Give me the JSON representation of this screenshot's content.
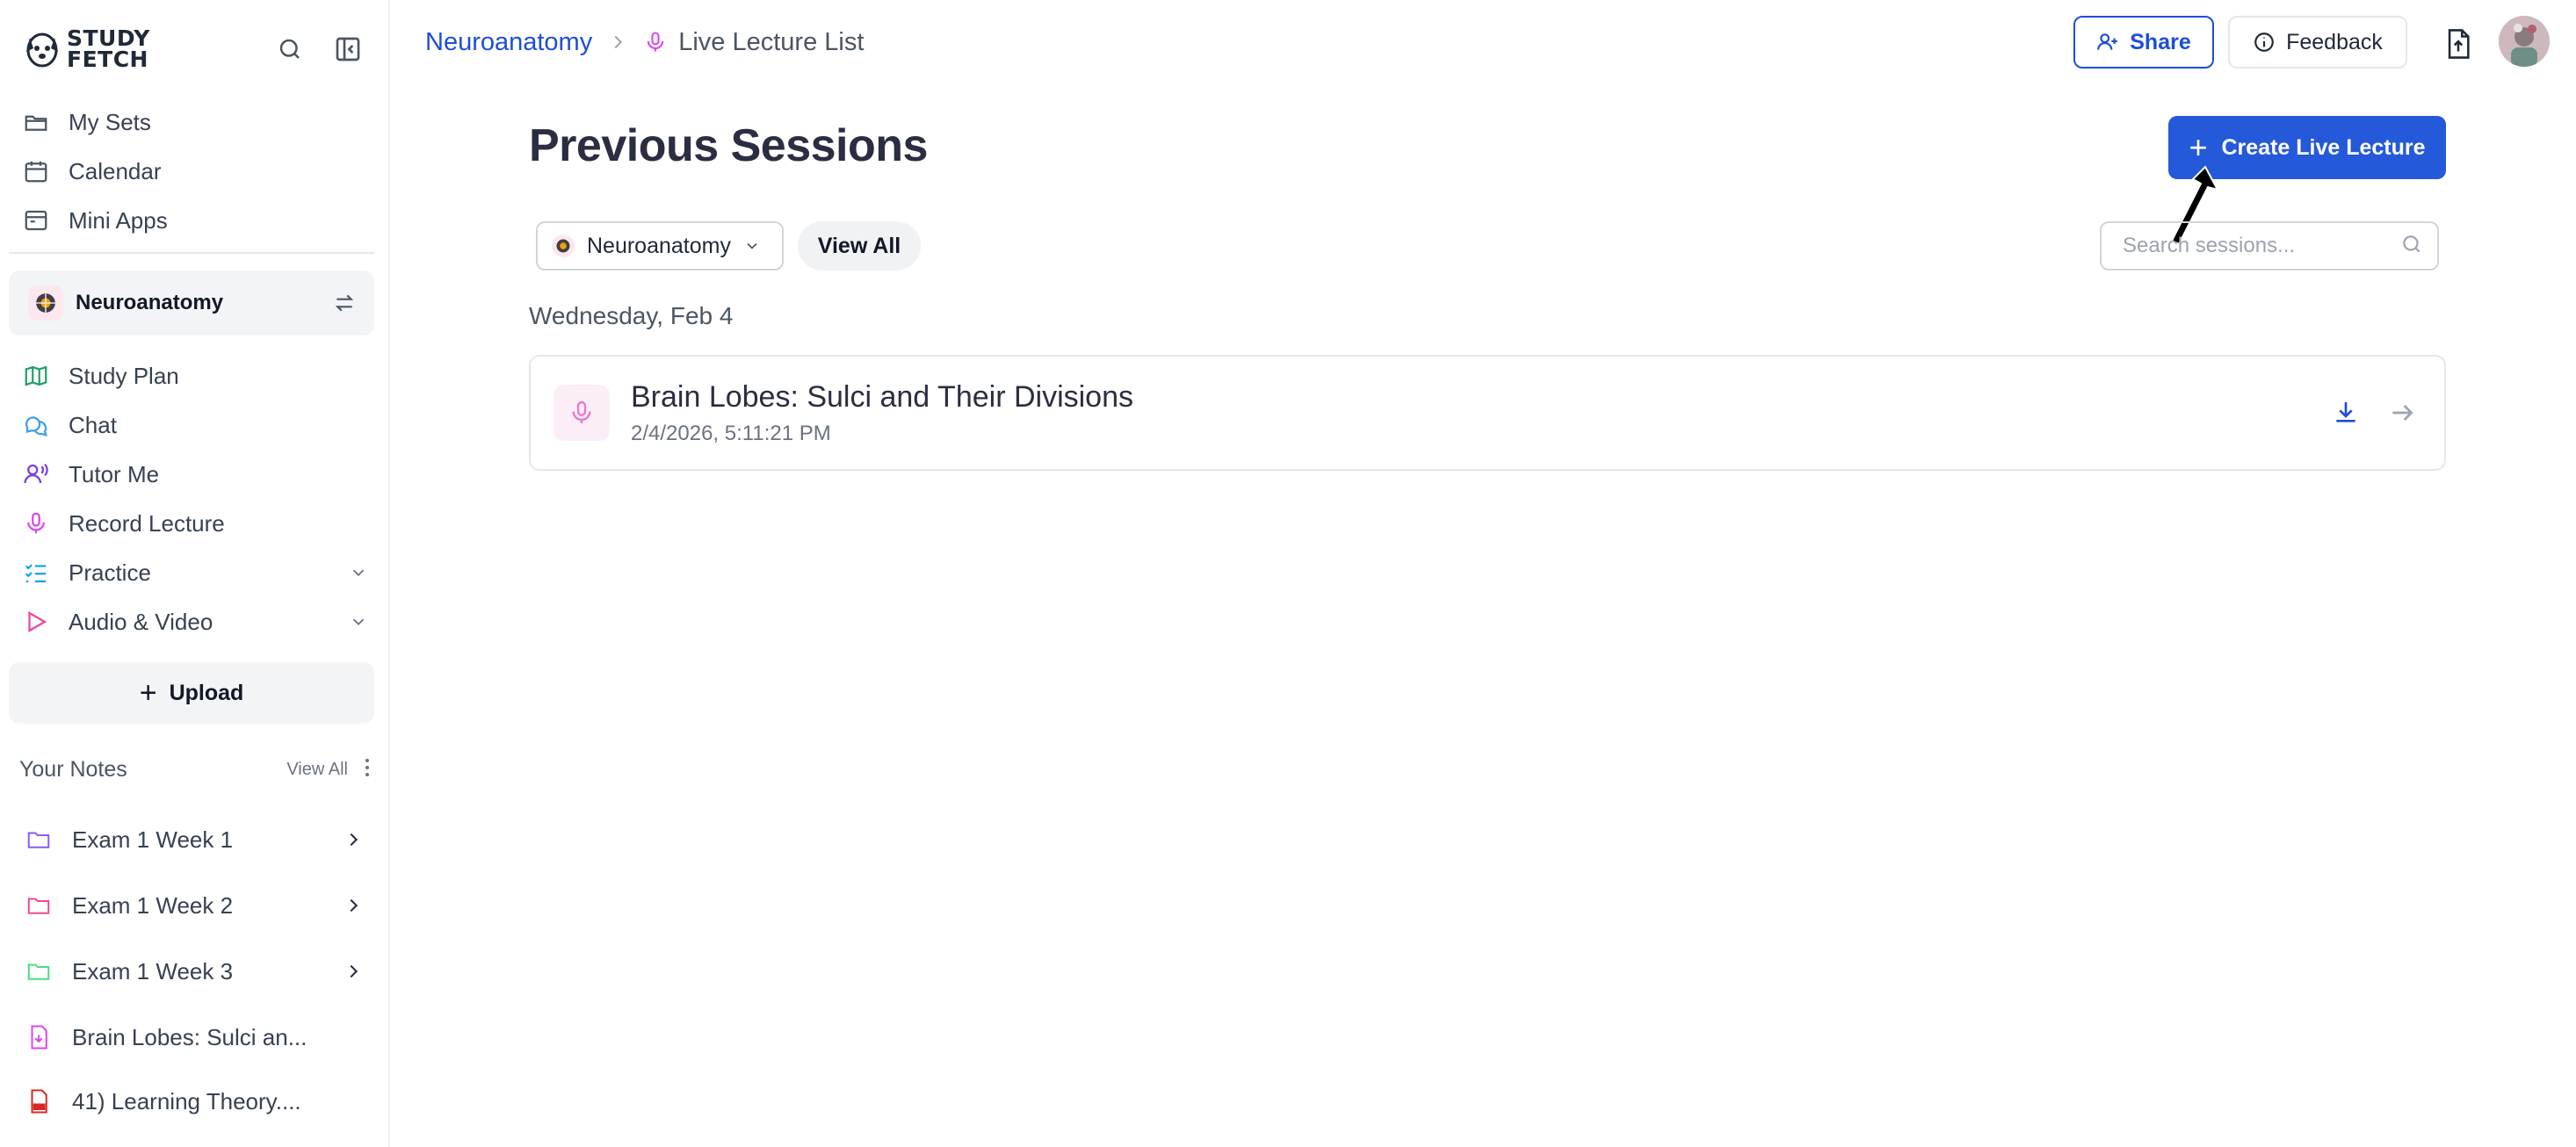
{
  "brand": {
    "logo_text_line1": "STUDY",
    "logo_text_line2": "FETCH"
  },
  "sidebar": {
    "top_nav": [
      {
        "label": "My Sets",
        "icon": "folder-open-icon"
      },
      {
        "label": "Calendar",
        "icon": "calendar-icon"
      },
      {
        "label": "Mini Apps",
        "icon": "app-window-icon"
      }
    ],
    "course": {
      "label": "Neuroanatomy"
    },
    "course_nav": [
      {
        "label": "Study Plan",
        "icon": "map-icon",
        "color": "#22a06b"
      },
      {
        "label": "Chat",
        "icon": "chat-bubbles-icon",
        "color": "#3aa0e8"
      },
      {
        "label": "Tutor Me",
        "icon": "tutor-voice-icon",
        "color": "#7c3aed"
      },
      {
        "label": "Record Lecture",
        "icon": "microphone-icon",
        "color": "#d946ef"
      },
      {
        "label": "Practice",
        "icon": "checklist-icon",
        "color": "#0ea5e9"
      },
      {
        "label": "Audio & Video",
        "icon": "play-icon",
        "color": "#ec4899"
      }
    ],
    "upload_label": "Upload",
    "notes": {
      "heading": "Your Notes",
      "view_all": "View All",
      "items": [
        {
          "label": "Exam 1 Week 1",
          "icon": "folder-icon",
          "color": "#8b5cf6"
        },
        {
          "label": "Exam 1 Week 2",
          "icon": "folder-icon",
          "color": "#ec4899"
        },
        {
          "label": "Exam 1 Week 3",
          "icon": "folder-icon",
          "color": "#4ade80"
        },
        {
          "label": "Brain Lobes: Sulci an...",
          "icon": "audio-file-icon",
          "color": "#d946ef"
        },
        {
          "label": "41) Learning Theory....",
          "icon": "pdf-file-icon",
          "color": "#dc2626"
        }
      ]
    }
  },
  "header": {
    "breadcrumb_course": "Neuroanatomy",
    "breadcrumb_current": "Live Lecture List",
    "share_label": "Share",
    "feedback_label": "Feedback"
  },
  "main": {
    "title": "Previous Sessions",
    "create_label": "Create Live Lecture",
    "filter_course": "Neuroanatomy",
    "view_all_label": "View All",
    "search_placeholder": "Search sessions...",
    "groups": [
      {
        "date": "Wednesday, Feb 4",
        "sessions": [
          {
            "title": "Brain Lobes: Sulci and Their Divisions",
            "timestamp": "2/4/2026, 5:11:21 PM"
          }
        ]
      }
    ]
  },
  "colors": {
    "accent": "#2459d9",
    "link": "#1d4ed8",
    "title": "#2b2d42"
  }
}
